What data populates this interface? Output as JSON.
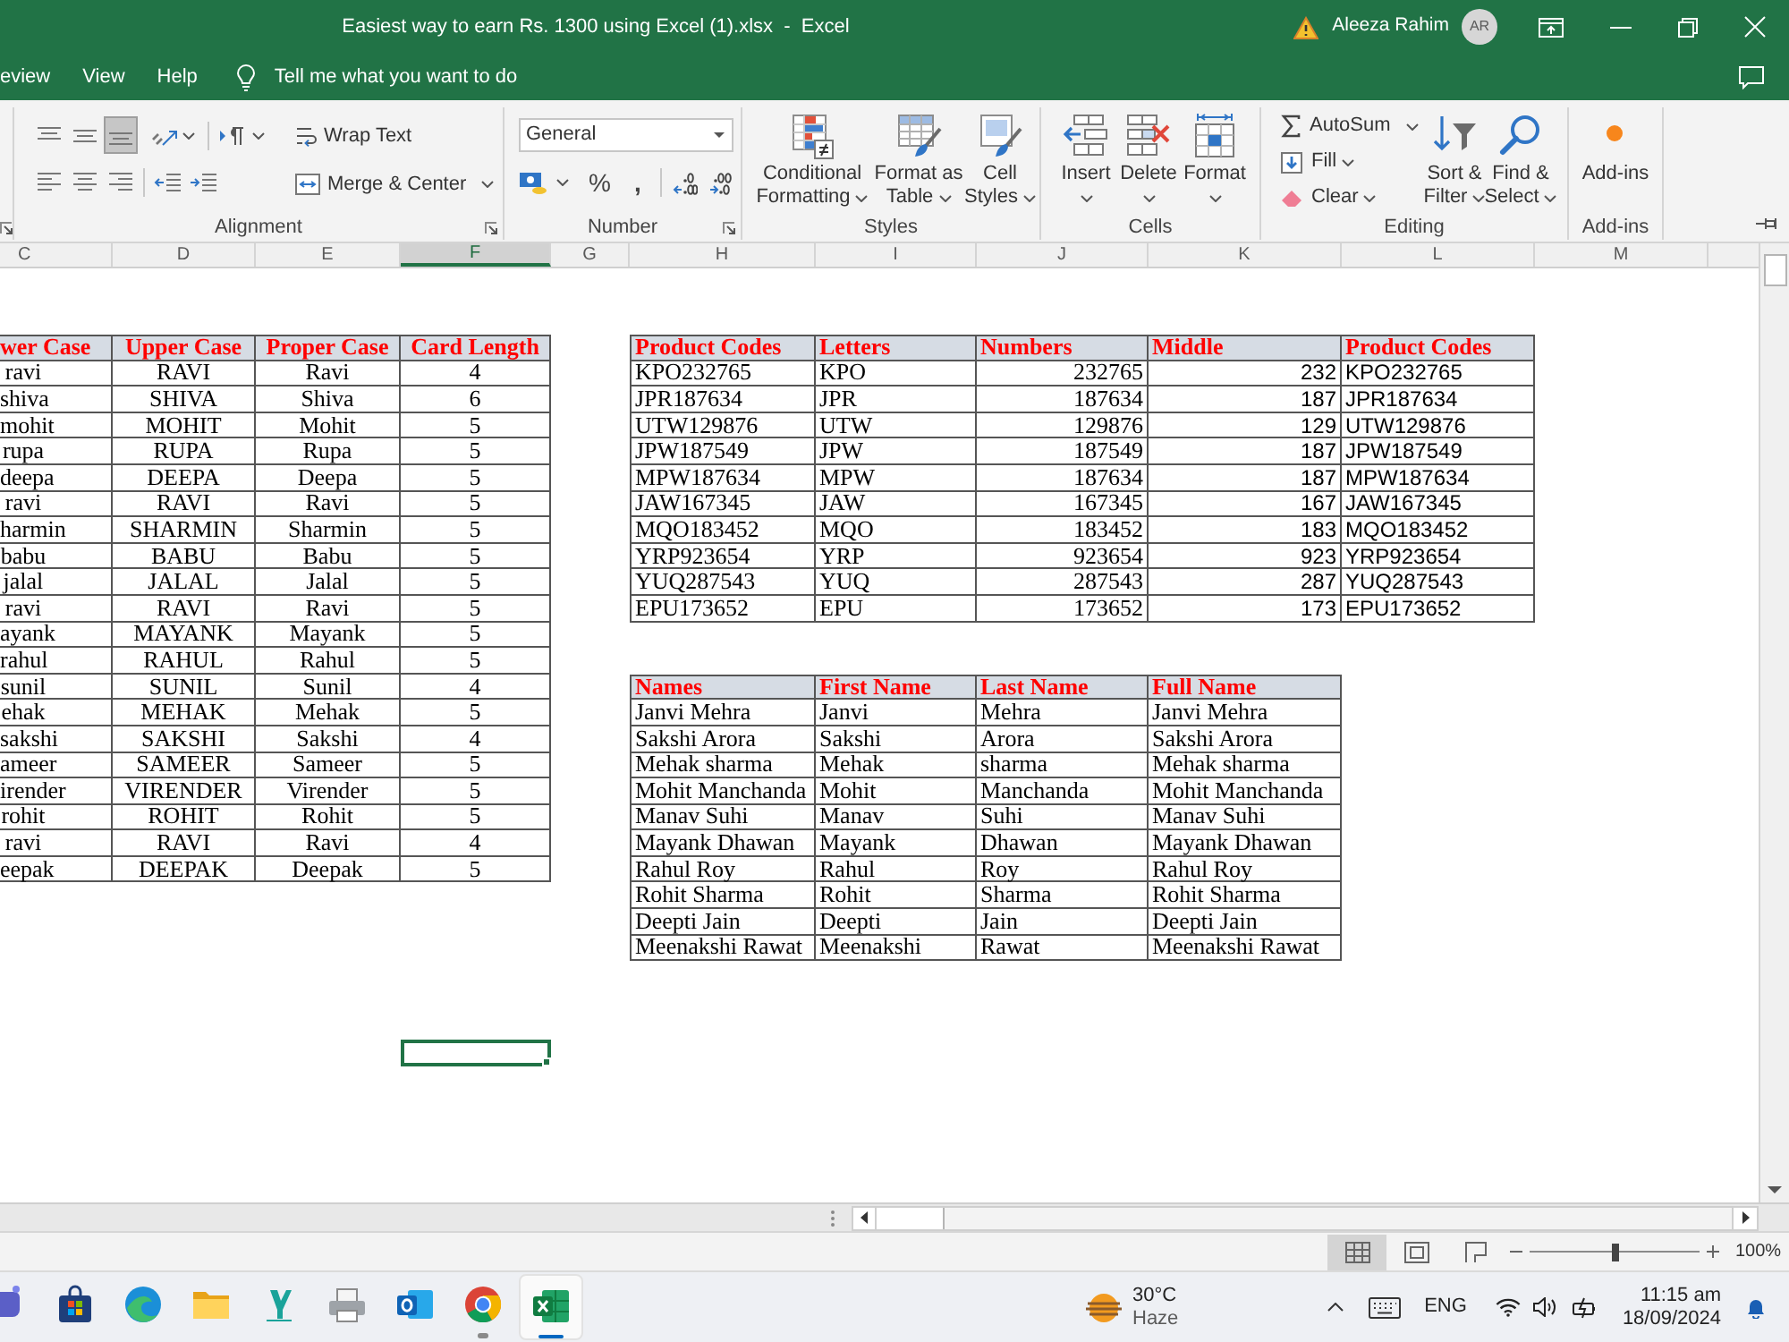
{
  "window": {
    "title": "Easiest way to earn Rs. 1300 using Excel (1).xlsx  -  Excel",
    "user_name": "Aleeza Rahim",
    "avatar_initials": "AR"
  },
  "menu_tabs": [
    {
      "label": "eview",
      "selected": false
    },
    {
      "label": "View",
      "selected": false
    },
    {
      "label": "Help",
      "selected": false
    }
  ],
  "tell_me": {
    "placeholder": "Tell me what you want to do"
  },
  "ribbon": {
    "alignment": {
      "label": "Alignment",
      "vertical_align": [
        {
          "kind": "top",
          "selected": false
        },
        {
          "kind": "middle",
          "selected": false
        },
        {
          "kind": "bottom",
          "selected": true
        }
      ],
      "horizontal_align": [
        {
          "kind": "left",
          "selected": false
        },
        {
          "kind": "center",
          "selected": false
        },
        {
          "kind": "right",
          "selected": false
        }
      ],
      "wrap_text": "Wrap Text",
      "merge_center": "Merge & Center"
    },
    "number": {
      "label": "Number",
      "format": "General",
      "percent": "%",
      "comma": ","
    },
    "styles": {
      "label": "Styles",
      "buttons": [
        {
          "kind": "conditional",
          "lines": [
            "Conditional",
            "Formatting"
          ]
        },
        {
          "kind": "table",
          "lines": [
            "Format as",
            "Table"
          ]
        },
        {
          "kind": "cell",
          "lines": [
            "Cell",
            "Styles"
          ]
        }
      ]
    },
    "cells": {
      "label": "Cells",
      "buttons": [
        {
          "kind": "insert",
          "label": "Insert"
        },
        {
          "kind": "delete",
          "label": "Delete"
        },
        {
          "kind": "format",
          "label": "Format"
        }
      ]
    },
    "editing": {
      "label": "Editing",
      "small_buttons": [
        {
          "kind": "autosum",
          "label": "AutoSum"
        },
        {
          "kind": "fill",
          "label": "Fill"
        },
        {
          "kind": "clear",
          "label": "Clear"
        }
      ],
      "large_buttons": [
        {
          "kind": "sort",
          "lines": [
            "Sort &",
            "Filter"
          ]
        },
        {
          "kind": "find",
          "lines": [
            "Find &",
            "Select"
          ]
        }
      ]
    },
    "addins": {
      "label": "Add-ins",
      "button": "Add-ins"
    }
  },
  "column_headers": [
    {
      "label": "C",
      "selected": false
    },
    {
      "label": "D",
      "selected": false
    },
    {
      "label": "E",
      "selected": false
    },
    {
      "label": "F",
      "selected": true
    },
    {
      "label": "G",
      "selected": false
    },
    {
      "label": "H",
      "selected": false
    },
    {
      "label": "I",
      "selected": false
    },
    {
      "label": "J",
      "selected": false
    },
    {
      "label": "K",
      "selected": false
    },
    {
      "label": "L",
      "selected": false
    },
    {
      "label": "M",
      "selected": false
    }
  ],
  "case_table": {
    "columns": [
      "wer Case",
      "Upper Case",
      "Proper Case",
      "Card Length"
    ],
    "rows": [
      [
        "ravi",
        "RAVI",
        "Ravi",
        "4"
      ],
      [
        "shiva",
        "SHIVA",
        "Shiva",
        "6"
      ],
      [
        "mohit",
        "MOHIT",
        "Mohit",
        "5"
      ],
      [
        "rupa",
        "RUPA",
        "Rupa",
        "5"
      ],
      [
        "deepa",
        "DEEPA",
        "Deepa",
        "5"
      ],
      [
        "ravi",
        "RAVI",
        "Ravi",
        "5"
      ],
      [
        "harmin",
        "SHARMIN",
        "Sharmin",
        "5"
      ],
      [
        "babu",
        "BABU",
        "Babu",
        "5"
      ],
      [
        "jalal",
        "JALAL",
        "Jalal",
        "5"
      ],
      [
        "ravi",
        "RAVI",
        "Ravi",
        "5"
      ],
      [
        "ayank",
        "MAYANK",
        "Mayank",
        "5"
      ],
      [
        "rahul",
        "RAHUL",
        "Rahul",
        "5"
      ],
      [
        "sunil",
        "SUNIL",
        "Sunil",
        "4"
      ],
      [
        "ehak",
        "MEHAK",
        "Mehak",
        "5"
      ],
      [
        "sakshi",
        "SAKSHI",
        "Sakshi",
        "4"
      ],
      [
        "ameer",
        "SAMEER",
        "Sameer",
        "5"
      ],
      [
        "irender",
        "VIRENDER",
        "Virender",
        "5"
      ],
      [
        "rohit",
        "ROHIT",
        "Rohit",
        "5"
      ],
      [
        "ravi",
        "RAVI",
        "Ravi",
        "4"
      ],
      [
        "eepak",
        "DEEPAK",
        "Deepak",
        "5"
      ]
    ]
  },
  "product_table": {
    "columns": [
      "Product Codes",
      "Letters",
      "Numbers",
      "Middle",
      "Product Codes"
    ],
    "rows": [
      [
        "KPO232765",
        "KPO",
        "232765",
        "232",
        "KPO232765"
      ],
      [
        "JPR187634",
        "JPR",
        "187634",
        "187",
        "JPR187634"
      ],
      [
        "UTW129876",
        "UTW",
        "129876",
        "129",
        "UTW129876"
      ],
      [
        "JPW187549",
        "JPW",
        "187549",
        "187",
        "JPW187549"
      ],
      [
        "MPW187634",
        "MPW",
        "187634",
        "187",
        "MPW187634"
      ],
      [
        "JAW167345",
        "JAW",
        "167345",
        "167",
        "JAW167345"
      ],
      [
        "MQO183452",
        "MQO",
        "183452",
        "183",
        "MQO183452"
      ],
      [
        "YRP923654",
        "YRP",
        "923654",
        "923",
        "YRP923654"
      ],
      [
        "YUQ287543",
        "YUQ",
        "287543",
        "287",
        "YUQ287543"
      ],
      [
        "EPU173652",
        "EPU",
        "173652",
        "173",
        "EPU173652"
      ]
    ]
  },
  "names_table": {
    "columns": [
      "Names",
      "First Name",
      "Last Name",
      "Full Name"
    ],
    "rows": [
      [
        "Janvi Mehra",
        "Janvi",
        "Mehra",
        "Janvi Mehra"
      ],
      [
        "Sakshi Arora",
        "Sakshi",
        "Arora",
        "Sakshi Arora"
      ],
      [
        "Mehak sharma",
        "Mehak",
        "sharma",
        "Mehak sharma"
      ],
      [
        "Mohit Manchanda",
        "Mohit",
        "Manchanda",
        "Mohit Manchanda"
      ],
      [
        "Manav Suhi",
        "Manav",
        "Suhi",
        "Manav Suhi"
      ],
      [
        "Mayank Dhawan",
        "Mayank",
        "Dhawan",
        "Mayank Dhawan"
      ],
      [
        "Rahul Roy",
        "Rahul",
        "Roy",
        "Rahul Roy"
      ],
      [
        "Rohit Sharma",
        "Rohit",
        "Sharma",
        "Rohit Sharma"
      ],
      [
        "Deepti Jain",
        "Deepti",
        "Jain",
        "Deepti Jain"
      ],
      [
        "Meenakshi Rawat",
        "Meenakshi",
        "Rawat",
        "Meenakshi Rawat"
      ]
    ]
  },
  "status_bar": {
    "views": [
      {
        "kind": "normal",
        "selected": true
      },
      {
        "kind": "page_layout",
        "selected": false
      },
      {
        "kind": "page_break",
        "selected": false
      }
    ],
    "zoom": {
      "level": 0.5,
      "reading": "100%"
    }
  },
  "taskbar": {
    "apps": [
      {
        "kind": "chat",
        "running": false,
        "active": false
      },
      {
        "kind": "store",
        "running": false,
        "active": false
      },
      {
        "kind": "swirl",
        "running": false,
        "active": false
      },
      {
        "kind": "files",
        "running": false,
        "active": false
      },
      {
        "kind": "app",
        "running": false,
        "active": false
      },
      {
        "kind": "printer",
        "running": false,
        "active": false
      },
      {
        "kind": "mail",
        "running": false,
        "active": false
      },
      {
        "kind": "ball",
        "running": true,
        "active": false
      },
      {
        "kind": "sheet",
        "running": true,
        "active": true
      }
    ],
    "weather": {
      "temperature": "30°C",
      "condition": "Haze"
    },
    "language": "ENG",
    "time": "11:15 am",
    "date": "18/09/2024"
  }
}
